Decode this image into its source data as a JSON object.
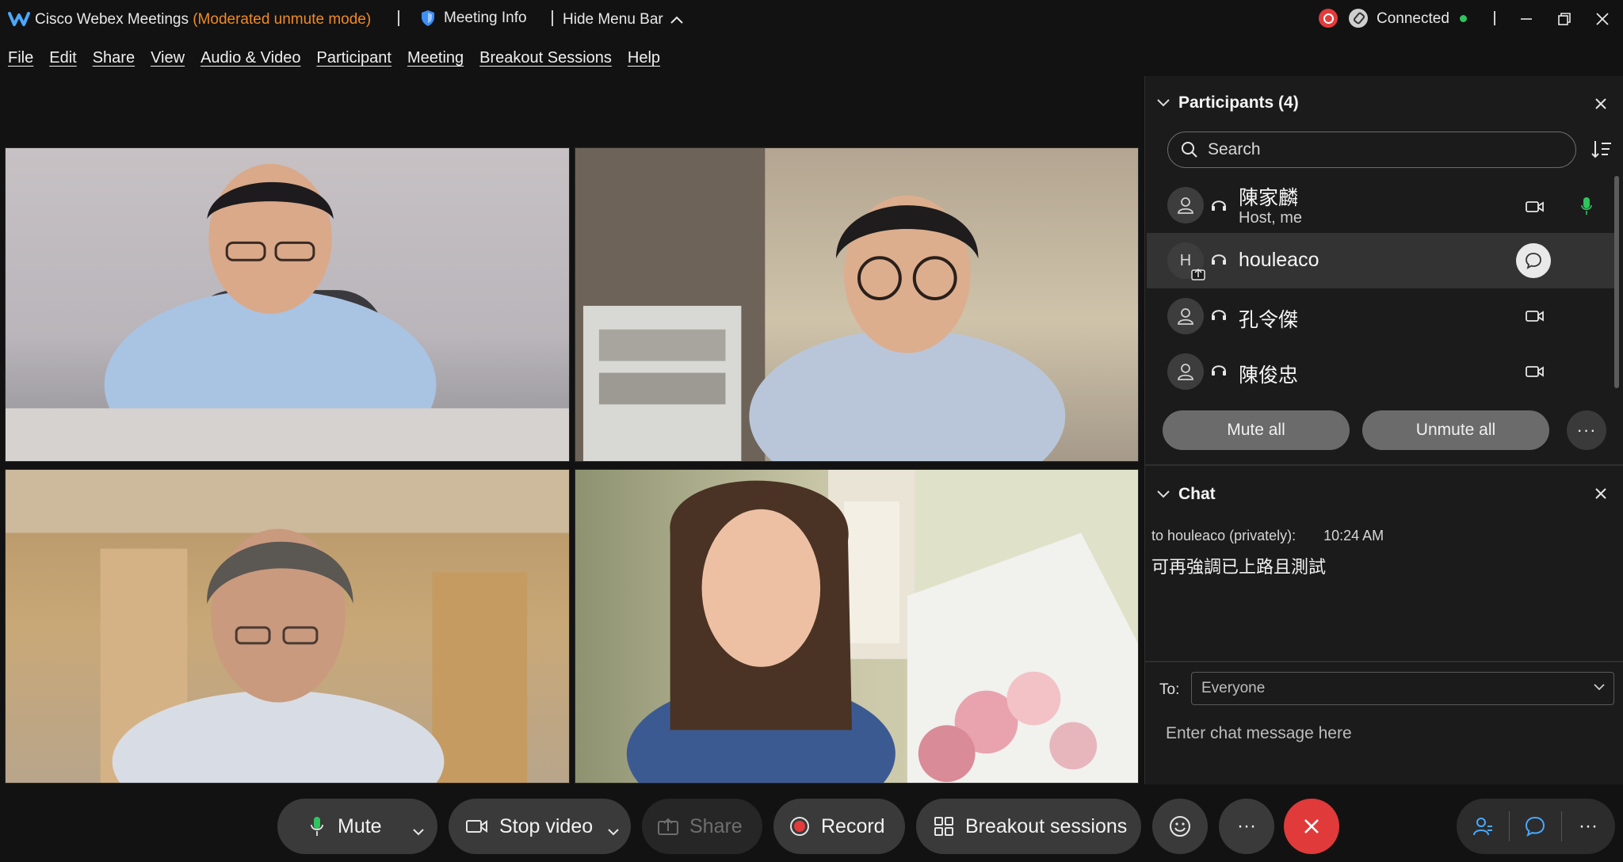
{
  "titlebar": {
    "app_name": "Cisco Webex Meetings",
    "mode": "(Moderated unmute mode)",
    "meeting_info": "Meeting Info",
    "hide_menu": "Hide Menu Bar",
    "status": "Connected"
  },
  "menu": [
    "File",
    "Edit",
    "Share",
    "View",
    "Audio & Video",
    "Participant",
    "Meeting",
    "Breakout Sessions",
    "Help"
  ],
  "participants": {
    "header": "Participants (4)",
    "search_placeholder": "Search",
    "list": [
      {
        "name": "陳家麟",
        "subtitle": "Host, me"
      },
      {
        "name": "houleaco",
        "initial": "H"
      },
      {
        "name": "孔令傑"
      },
      {
        "name": "陳俊忠"
      }
    ],
    "mute_all": "Mute all",
    "unmute_all": "Unmute all",
    "more": "···"
  },
  "chat": {
    "header": "Chat",
    "recipient_line": "to houleaco (privately):",
    "time": "10:24 AM",
    "message": "可再強調已上路且測試",
    "to_label": "To:",
    "to_value": "Everyone",
    "input_placeholder": "Enter chat message here"
  },
  "toolbar": {
    "mute": "Mute",
    "stop_video": "Stop video",
    "share": "Share",
    "record": "Record",
    "breakout": "Breakout sessions",
    "more": "···",
    "more_right": "···"
  },
  "colors": {
    "accent_orange": "#f08a24",
    "connected_green": "#2fc55e",
    "end_red": "#e03a3a",
    "record_red": "#e23b3b"
  }
}
